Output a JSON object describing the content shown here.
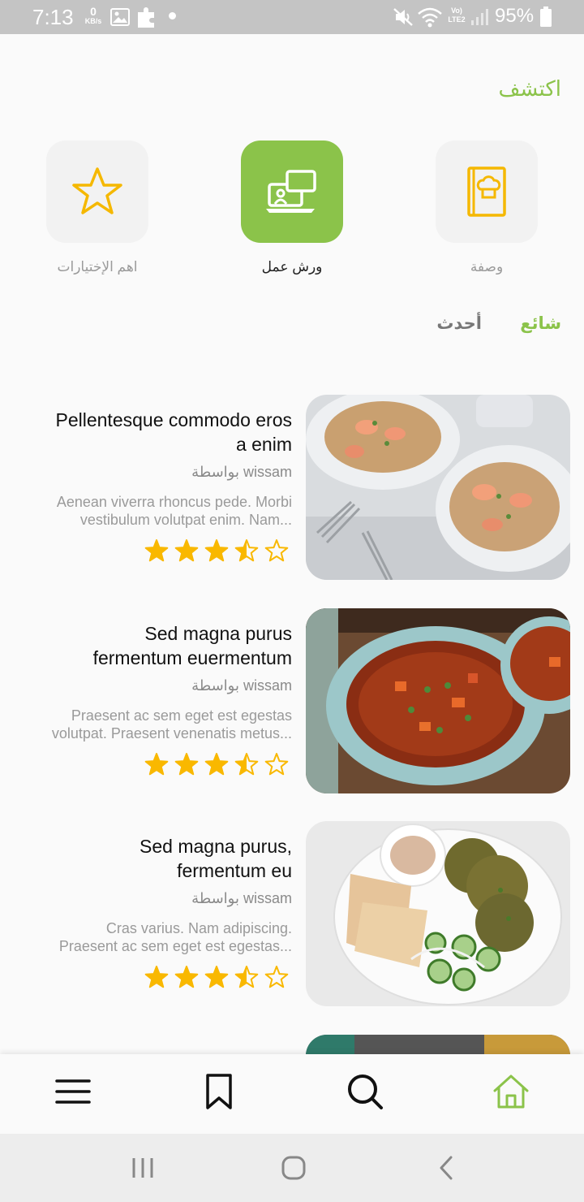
{
  "status_bar": {
    "time": "7:13",
    "net_speed_value": "0",
    "net_speed_unit": "KB/s",
    "network_label": "Vo) LTE2",
    "battery_percent": "95%",
    "icons": [
      "image-icon",
      "puzzle-icon",
      "dot-icon",
      "mute-icon",
      "wifi-icon",
      "signal-icon",
      "battery-icon"
    ]
  },
  "header": {
    "title": "اكتشف"
  },
  "categories": [
    {
      "label": "اهم الإختيارات",
      "icon": "star-icon",
      "active": false
    },
    {
      "label": "ورش عمل",
      "icon": "workshop-icon",
      "active": true
    },
    {
      "label": "وصفة",
      "icon": "recipe-book-icon",
      "active": false
    }
  ],
  "tabs": {
    "popular": "شائع",
    "latest": "أحدث"
  },
  "recipes": [
    {
      "title_line1": "Pellentesque commodo eros",
      "title_line2": "a enim",
      "author": "بواسطة wissam",
      "desc_line1": "Aenean viverra rhoncus pede. Morbi",
      "desc_line2": "vestibulum volutpat enim. Nam...",
      "rating": 3.5,
      "image": "shrimp-pasta"
    },
    {
      "title_line1": "Sed magna purus",
      "title_line2": "fermentum euermentum",
      "author": "بواسطة wissam",
      "desc_line1": "Praesent ac sem eget est egestas",
      "desc_line2": "volutpat. Praesent venenatis metus...",
      "rating": 3.5,
      "image": "vegetable-soup"
    },
    {
      "title_line1": "Sed magna purus,",
      "title_line2": "fermentum eu",
      "author": "بواسطة wissam",
      "desc_line1": "Cras varius. Nam adipiscing.",
      "desc_line2": "Praesent ac sem eget est egestas...",
      "rating": 3.5,
      "image": "falafel-plate"
    }
  ],
  "bottom_nav": [
    "menu-icon",
    "bookmark-icon",
    "search-icon",
    "home-icon"
  ],
  "colors": {
    "accent": "#8bc34a",
    "star": "#f9b800",
    "recipe_icon": "#f5b800"
  }
}
